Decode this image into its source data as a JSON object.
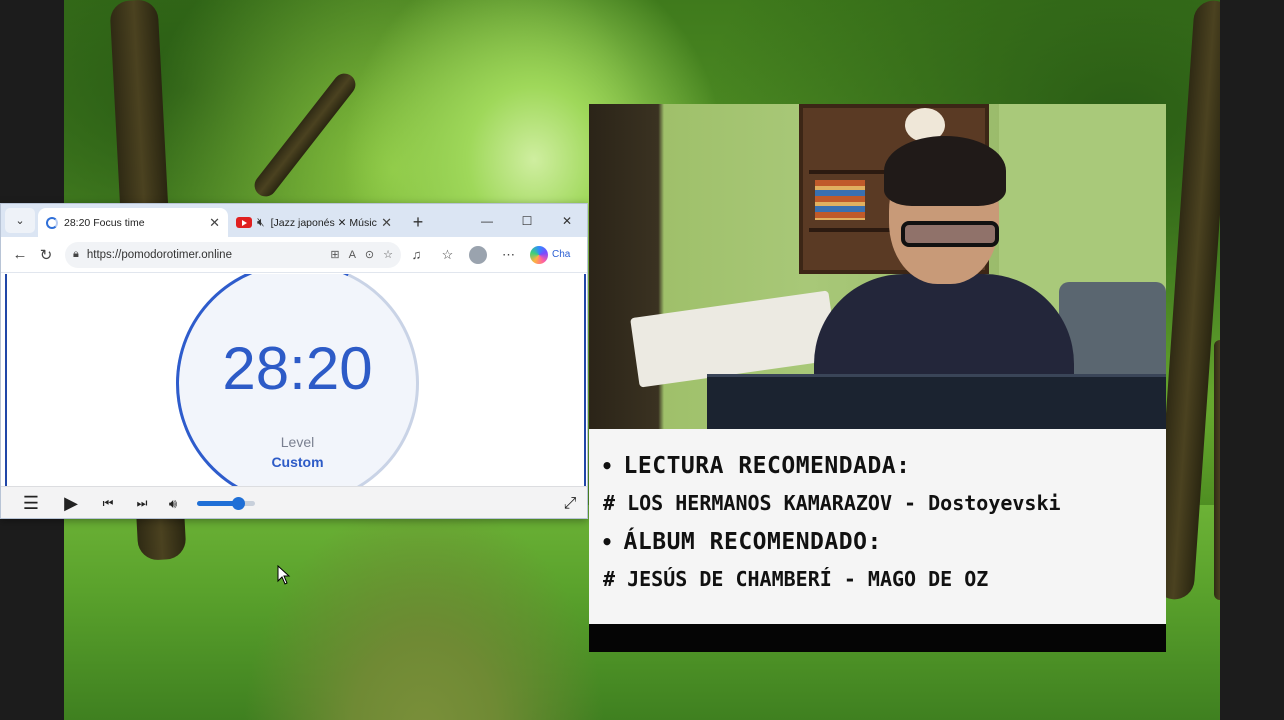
{
  "browser": {
    "tabs": [
      {
        "title": "28:20 Focus time",
        "icon": "loading-spinner-icon",
        "active": true
      },
      {
        "title": "[Jazz japonés ✕ Música d",
        "icon": "youtube-icon",
        "muted": true,
        "active": false
      }
    ],
    "tab_close": "✕",
    "new_tab": "+",
    "window_controls": {
      "minimize": "—",
      "maximize": "☐",
      "close": "✕"
    },
    "url": "https://pomodorotimer.online",
    "copilot_label": "Cha"
  },
  "timer": {
    "time": "28:20",
    "level_label": "Level",
    "level_value": "Custom",
    "remaining_fraction": 0.94
  },
  "player": {
    "volume_fraction": 0.7
  },
  "recommendations": {
    "reading_heading": "LECTURA RECOMENDADA:",
    "reading_item": "# LOS HERMANOS KAMARAZOV - Dostoyevski",
    "album_heading": "ÁLBUM RECOMENDADO:",
    "album_item": "# JESÚS DE CHAMBERÍ - MAGO DE OZ",
    "bullet": "•"
  },
  "colors": {
    "timer_blue": "#2d5bc7",
    "youtube_red": "#e02020",
    "tab_bar": "#dbe5f3"
  }
}
